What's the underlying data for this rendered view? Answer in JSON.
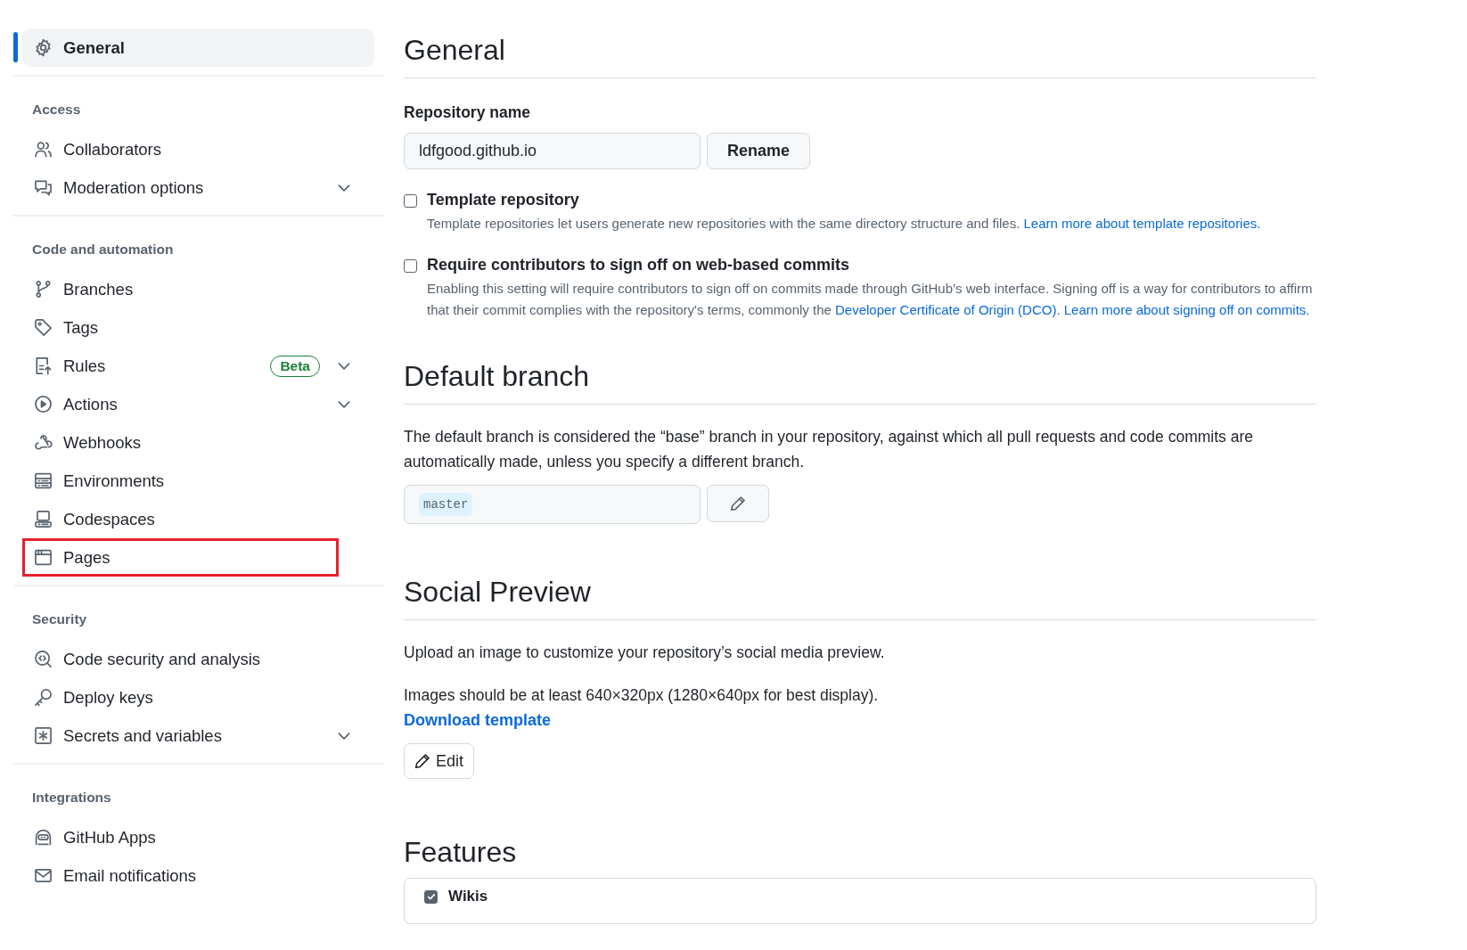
{
  "sidebar": {
    "sections": [
      {
        "items": [
          {
            "label": "General",
            "selected": true,
            "expandable": false,
            "highlighted": false
          }
        ]
      },
      {
        "heading": "Access",
        "items": [
          {
            "label": "Collaborators",
            "selected": false,
            "expandable": false,
            "highlighted": false
          },
          {
            "label": "Moderation options",
            "selected": false,
            "expandable": true,
            "highlighted": false
          }
        ]
      },
      {
        "heading": "Code and automation",
        "items": [
          {
            "label": "Branches",
            "selected": false,
            "expandable": false,
            "highlighted": false
          },
          {
            "label": "Tags",
            "selected": false,
            "expandable": false,
            "highlighted": false
          },
          {
            "label": "Rules",
            "badge": "Beta",
            "selected": false,
            "expandable": true,
            "highlighted": false
          },
          {
            "label": "Actions",
            "selected": false,
            "expandable": true,
            "highlighted": false
          },
          {
            "label": "Webhooks",
            "selected": false,
            "expandable": false,
            "highlighted": false
          },
          {
            "label": "Environments",
            "selected": false,
            "expandable": false,
            "highlighted": false
          },
          {
            "label": "Codespaces",
            "selected": false,
            "expandable": false,
            "highlighted": false
          },
          {
            "label": "Pages",
            "selected": false,
            "expandable": false,
            "highlighted": true
          }
        ]
      },
      {
        "heading": "Security",
        "items": [
          {
            "label": "Code security and analysis",
            "selected": false,
            "expandable": false,
            "highlighted": false
          },
          {
            "label": "Deploy keys",
            "selected": false,
            "expandable": false,
            "highlighted": false
          },
          {
            "label": "Secrets and variables",
            "selected": false,
            "expandable": true,
            "highlighted": false
          }
        ]
      },
      {
        "heading": "Integrations",
        "items": [
          {
            "label": "GitHub Apps",
            "selected": false,
            "expandable": false,
            "highlighted": false
          },
          {
            "label": "Email notifications",
            "selected": false,
            "expandable": false,
            "highlighted": false
          }
        ]
      }
    ]
  },
  "general": {
    "title": "General",
    "repo_name_label": "Repository name",
    "repo_name_value": "ldfgood.github.io",
    "rename_button": "Rename",
    "options": [
      {
        "label": "Template repository",
        "checked": false,
        "description": "Template repositories let users generate new repositories with the same directory structure and files. ",
        "link": "Learn more about template repositories."
      },
      {
        "label": "Require contributors to sign off on web-based commits",
        "checked": false,
        "description": "Enabling this setting will require contributors to sign off on commits made through GitHub’s web interface. Signing off is a way for contributors to affirm that their commit complies with the repository's terms, commonly the ",
        "link": "Developer Certificate of Origin (DCO).",
        "link2": "Learn more about signing off on commits."
      }
    ]
  },
  "default_branch": {
    "title": "Default branch",
    "description": "The default branch is considered the “base” branch in your repository, against which all pull requests and code commits are automatically made, unless you specify a different branch.",
    "branch": "master"
  },
  "social_preview": {
    "title": "Social Preview",
    "description": "Upload an image to customize your repository’s social media preview.",
    "size_note": "Images should be at least 640×320px (1280×640px for best display).",
    "download_link": "Download template",
    "edit_button": "Edit"
  },
  "features": {
    "title": "Features",
    "items": [
      {
        "label": "Wikis",
        "checked": true
      }
    ]
  }
}
